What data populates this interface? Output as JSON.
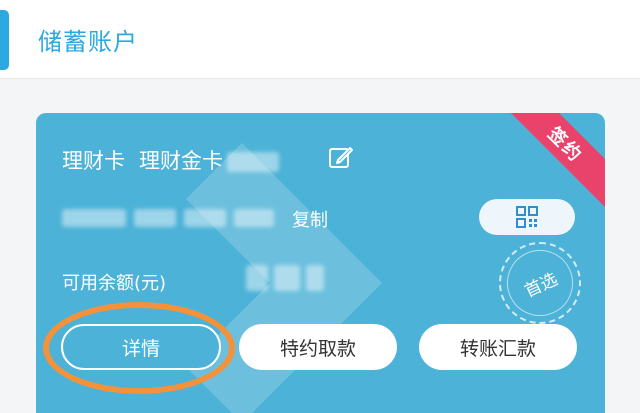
{
  "header": {
    "title": "储蓄账户"
  },
  "card": {
    "ribbon_label": "签约",
    "card_type": "理财卡",
    "card_name": "理财金卡",
    "copy_label": "复制",
    "balance_label": "可用余额(元)",
    "primary_badge": "首选",
    "colors": {
      "card": "#4cb2d7",
      "ribbon": "#e9436b",
      "highlight": "#f3923a",
      "accent": "#2ba9e0"
    }
  },
  "actions": {
    "detail": "详情",
    "special_withdraw": "特约取款",
    "transfer": "转账汇款"
  },
  "icons": {
    "edit": "edit-icon",
    "qr": "qr-code-icon"
  }
}
